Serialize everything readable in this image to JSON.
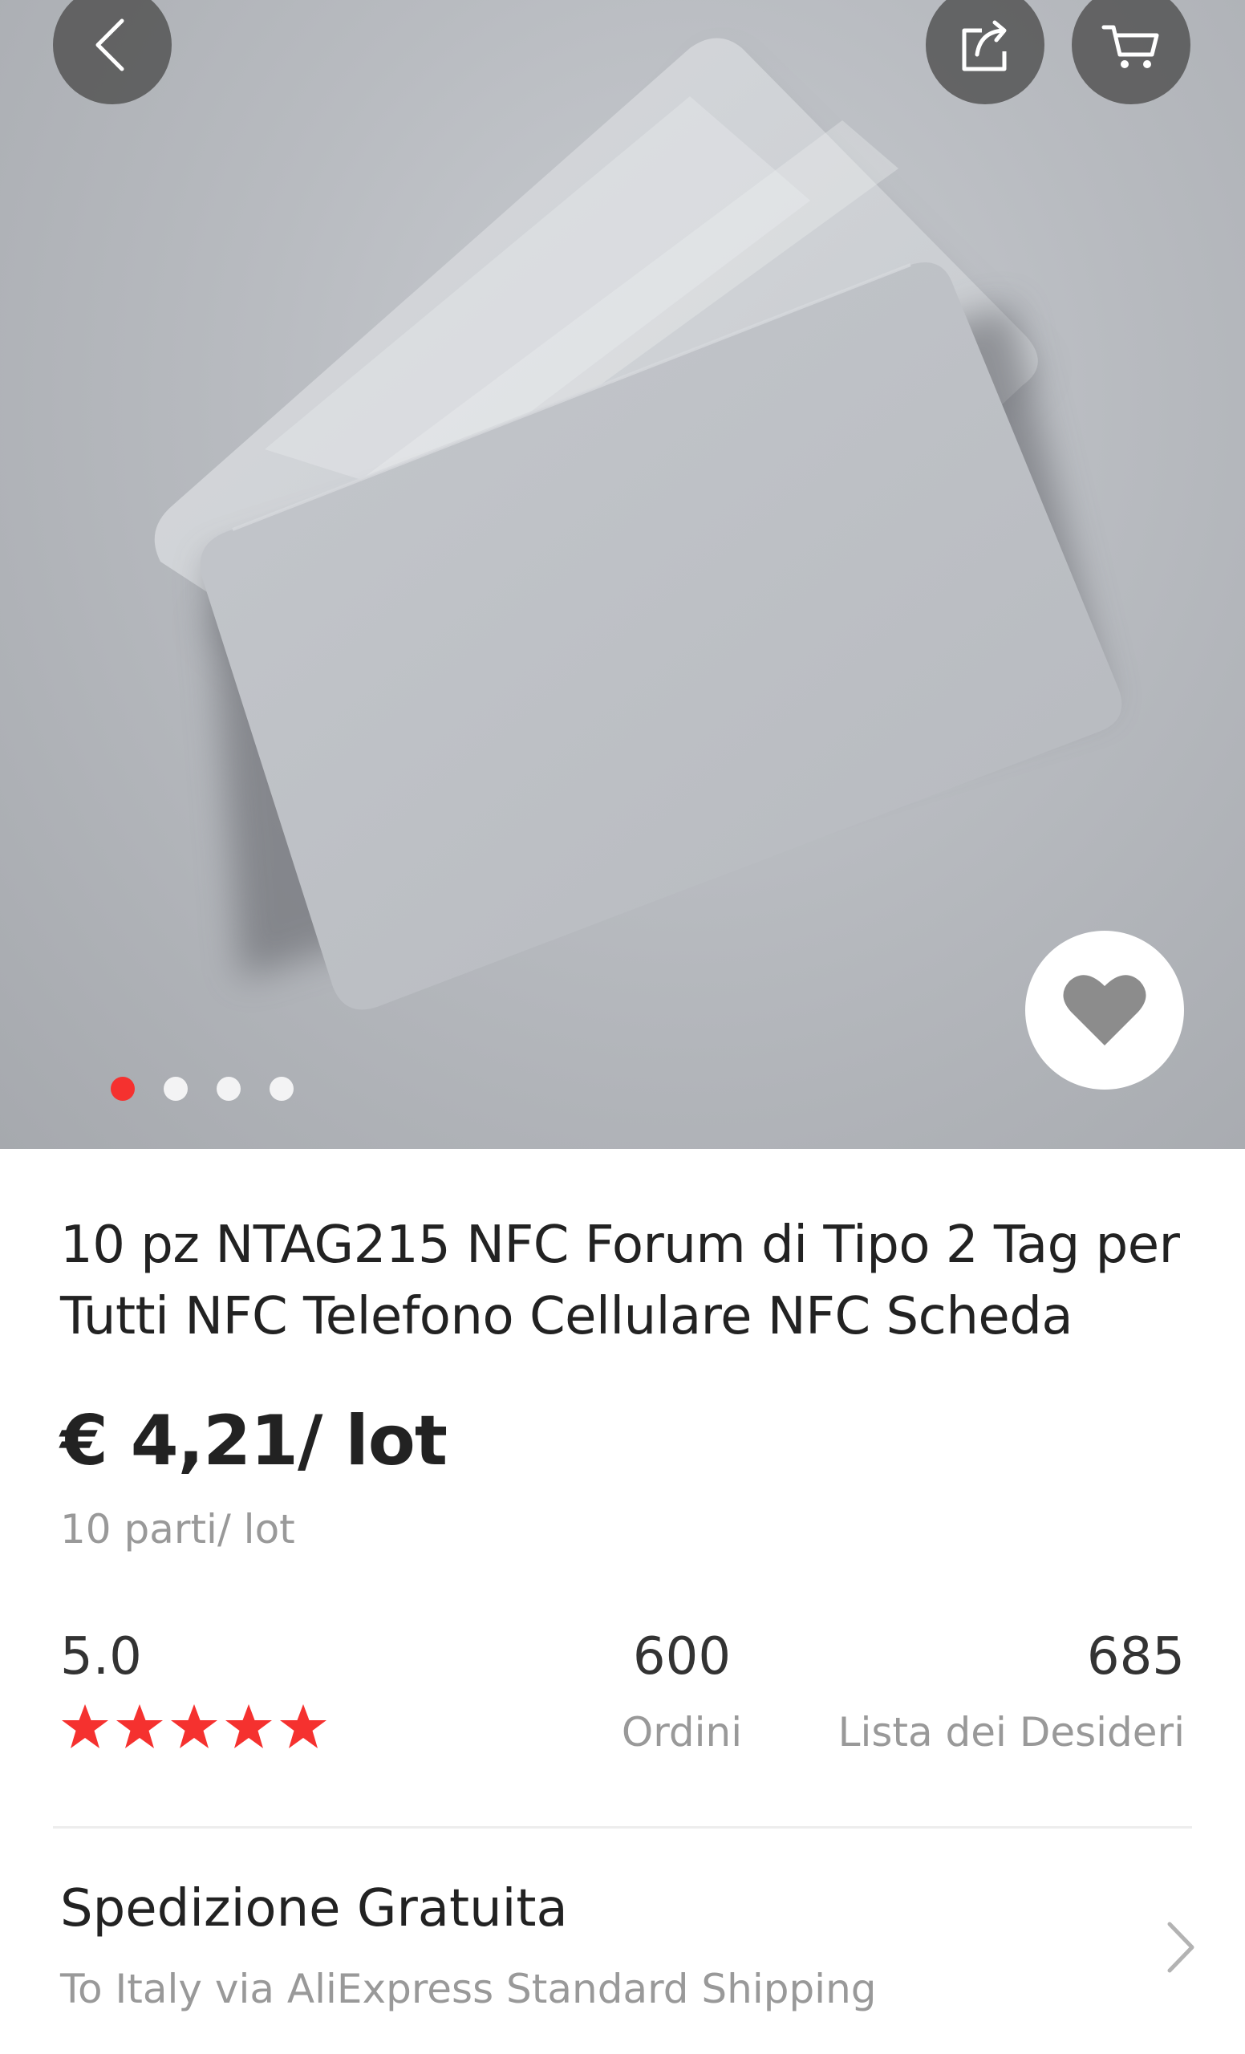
{
  "product": {
    "title": "10 pz NTAG215 NFC Forum di Tipo 2 Tag per Tutti NFC Telefono Cellulare NFC Scheda",
    "price": "€ 4,21/ lot",
    "unit_note": "10 parti/ lot"
  },
  "gallery": {
    "image_count": 4,
    "active_index": 0,
    "active_dot_color": "#f5312f"
  },
  "stats": {
    "rating": "5.0",
    "stars": 5,
    "star_color": "#f5312f",
    "orders_count": "600",
    "orders_label": "Ordini",
    "wishlist_count": "685",
    "wishlist_label": "Lista dei Desideri"
  },
  "shipping": {
    "title": "Spedizione Gratuita",
    "subtitle": "To Italy via AliExpress Standard Shipping"
  },
  "icons": {
    "back": "chevron-left-icon",
    "share": "share-icon",
    "cart": "cart-icon",
    "wishlist": "heart-icon",
    "shipping_chevron": "chevron-right-icon"
  }
}
